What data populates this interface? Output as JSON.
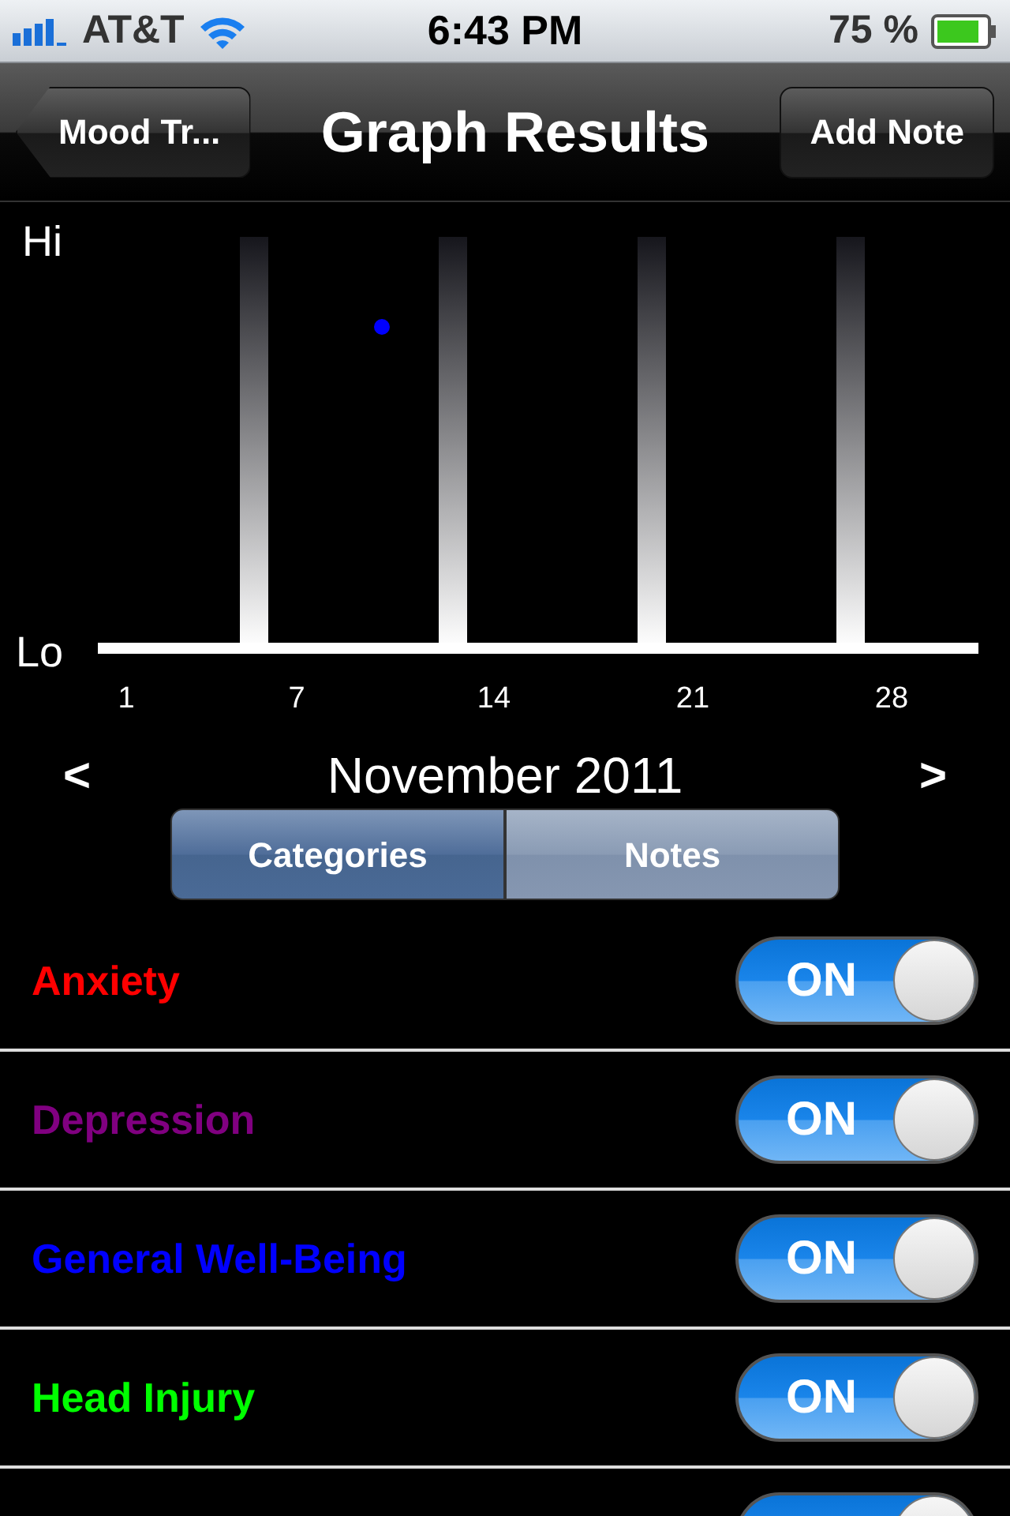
{
  "status_bar": {
    "carrier": "AT&T",
    "time": "6:43 PM",
    "battery": "75 %"
  },
  "nav_bar": {
    "back_button": "Mood Tr...",
    "title": "Graph Results",
    "right_button": "Add Note"
  },
  "graph": {
    "y_axis_labels": {
      "top": "Hi",
      "bottom": "Lo"
    },
    "x_axis_labels": [
      "1",
      "7",
      "14",
      "21",
      "28"
    ]
  },
  "month_nav": {
    "prev": "<",
    "month": "November 2011",
    "next": ">"
  },
  "segments": [
    {
      "label": "Categories",
      "selected": true
    },
    {
      "label": "Notes",
      "selected": false
    }
  ],
  "categories": [
    {
      "label": "Anxiety",
      "color": "#ff0000",
      "on": true,
      "switch_text": "ON"
    },
    {
      "label": "Depression",
      "color": "#800080",
      "on": true,
      "switch_text": "ON"
    },
    {
      "label": "General Well-Being",
      "color": "#0000ff",
      "on": true,
      "switch_text": "ON"
    },
    {
      "label": "Head Injury",
      "color": "#00ff00",
      "on": true,
      "switch_text": "ON"
    },
    {
      "on": true
    }
  ]
}
